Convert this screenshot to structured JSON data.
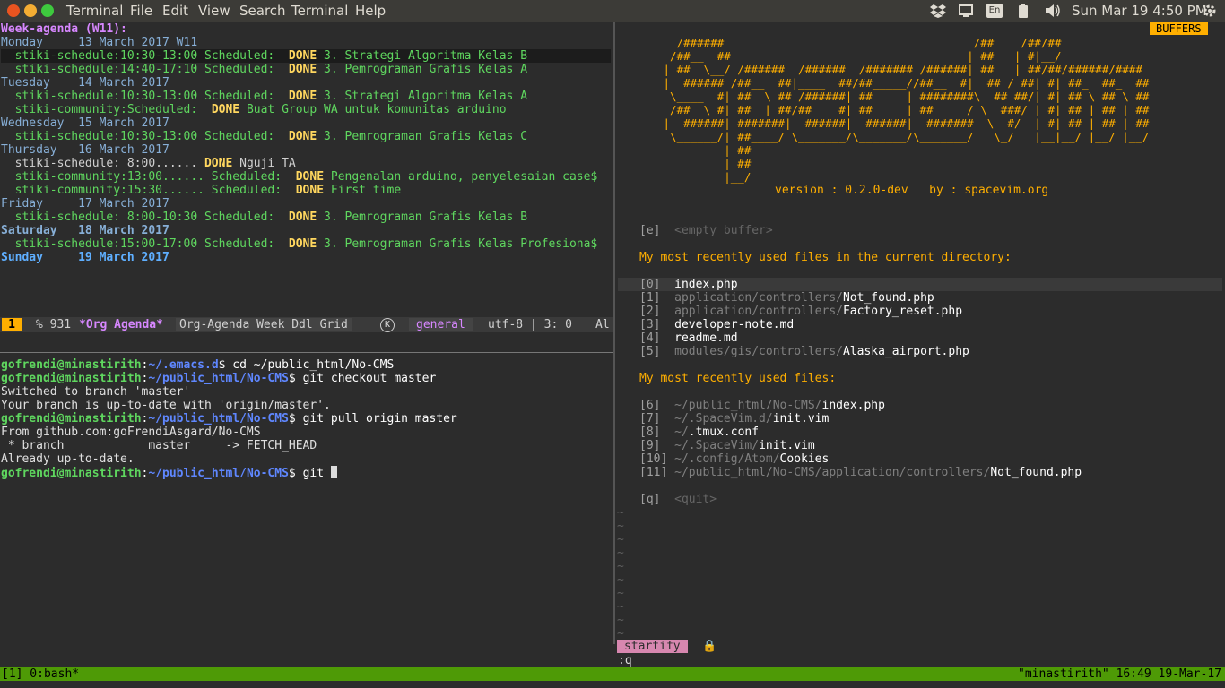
{
  "topbar": {
    "menus": [
      "Terminal",
      "File",
      "Edit",
      "View",
      "Search",
      "Terminal",
      "Help"
    ],
    "keyboard_indicator": "En",
    "clock": "Sun Mar 19  4:50 PM"
  },
  "agenda": {
    "header": "Week-agenda (W11):",
    "lines": [
      {
        "type": "day",
        "text": "Monday     13 March 2017 W11"
      },
      {
        "type": "sched",
        "pre": "  stiki-schedule:10:30-13:00 Scheduled:  ",
        "kw": "DONE",
        "post": " 3. Strategi Algoritma Kelas B",
        "hl": true
      },
      {
        "type": "sched",
        "pre": "  stiki-schedule:14:40-17:10 Scheduled:  ",
        "kw": "DONE",
        "post": " 3. Pemrograman Grafis Kelas A"
      },
      {
        "type": "day",
        "text": "Tuesday    14 March 2017"
      },
      {
        "type": "sched",
        "pre": "  stiki-schedule:10:30-13:00 Scheduled:  ",
        "kw": "DONE",
        "post": " 3. Strategi Algoritma Kelas A"
      },
      {
        "type": "sched",
        "pre": "  stiki-community:Scheduled:  ",
        "kw": "DONE",
        "post": " Buat Group WA untuk komunitas arduino"
      },
      {
        "type": "day",
        "text": "Wednesday  15 March 2017"
      },
      {
        "type": "sched",
        "pre": "  stiki-schedule:10:30-13:00 Scheduled:  ",
        "kw": "DONE",
        "post": " 3. Pemrograman Grafis Kelas C"
      },
      {
        "type": "day",
        "text": "Thursday   16 March 2017"
      },
      {
        "type": "plain",
        "pre": "  stiki-schedule: 8:00...... ",
        "kw": "DONE",
        "post": " Nguji TA"
      },
      {
        "type": "sched",
        "pre": "  stiki-community:13:00...... Scheduled:  ",
        "kw": "DONE",
        "post": " Pengenalan arduino, penyelesaian case$"
      },
      {
        "type": "sched",
        "pre": "  stiki-community:15:30...... Scheduled:  ",
        "kw": "DONE",
        "post": " First time"
      },
      {
        "type": "day",
        "text": "Friday     17 March 2017"
      },
      {
        "type": "sched",
        "pre": "  stiki-schedule: 8:00-10:30 Scheduled:  ",
        "kw": "DONE",
        "post": " 3. Pemrograman Grafis Kelas B"
      },
      {
        "type": "weekend",
        "text": "Saturday   18 March 2017"
      },
      {
        "type": "sched",
        "pre": "  stiki-schedule:15:00-17:00 Scheduled:  ",
        "kw": "DONE",
        "post": " 3. Pemrograman Grafis Kelas Profesiona$"
      },
      {
        "type": "today",
        "text": "Sunday     19 March 2017"
      }
    ]
  },
  "emacs_status": {
    "window_number": "1",
    "position": "% 931",
    "buffer": "*Org Agenda*",
    "mode": "Org-Agenda Week Ddl Grid",
    "k": "K",
    "workspace": "general",
    "encoding": "utf-8 | 3: 0",
    "tail": "Al"
  },
  "shell": {
    "user_host": "gofrendi@minastirith",
    "lines": [
      {
        "path": "~/.emacs.d",
        "cmd": " cd ~/public_html/No-CMS"
      },
      {
        "path": "~/public_html/No-CMS",
        "cmd": " git checkout master"
      },
      {
        "out": "Switched to branch 'master'"
      },
      {
        "out": "Your branch is up-to-date with 'origin/master'."
      },
      {
        "path": "~/public_html/No-CMS",
        "cmd": " git pull origin master"
      },
      {
        "out": "From github.com:goFrendiAsgard/No-CMS"
      },
      {
        "out": " * branch            master     -> FETCH_HEAD"
      },
      {
        "out": "Already up-to-date."
      },
      {
        "path": "~/public_html/No-CMS",
        "cmd": " git "
      }
    ]
  },
  "spacevim": {
    "buffers_label": "BUFFERS",
    "banner": [
      "   /######                                     /##    /##/##",
      "  /##__  ##                                   | ##   | #|__/",
      " | ##  \\__/ /######  /######  /####### /######| ##   | ##/##/######/####",
      " |  ###### /##__  ##|____  ##/##_____//##__  #|  ## / ##| #| ##_  ##_  ##",
      "  \\____  #| ##  \\ ## /######| ##     | ########\\  ## ##/| #| ## \\ ## \\ ##",
      "  /##  \\ #| ##  | ##/##__  #| ##     | ##_____/ \\  ###/ | #| ## | ## | ##",
      " |  ######| #######|  ######|  ######|  #######  \\  #/  | #| ## | ## | ##",
      "  \\______/| ##____/ \\_______/\\_______/\\_______/   \\_/   |__|__/ |__/ |__/",
      "          | ##",
      "          | ##",
      "          |__/"
    ],
    "version_line": "version : 0.2.0-dev   by : spacevim.org",
    "empty_key": "[e]",
    "empty_label": "<empty buffer>",
    "recent_dir_heading": "My most recently used files in the current directory:",
    "recent_dir": [
      {
        "key": "[0]",
        "dir": "",
        "file": "index.php"
      },
      {
        "key": "[1]",
        "dir": "application/controllers/",
        "file": "Not_found.php"
      },
      {
        "key": "[2]",
        "dir": "application/controllers/",
        "file": "Factory_reset.php"
      },
      {
        "key": "[3]",
        "dir": "",
        "file": "developer-note.md"
      },
      {
        "key": "[4]",
        "dir": "",
        "file": "readme.md"
      },
      {
        "key": "[5]",
        "dir": "modules/gis/controllers/",
        "file": "Alaska_airport.php"
      }
    ],
    "recent_heading": "My most recently used files:",
    "recent": [
      {
        "key": "[6]",
        "dir": "~/public_html/No-CMS/",
        "file": "index.php"
      },
      {
        "key": "[7]",
        "dir": "~/.SpaceVim.d/",
        "file": "init.vim"
      },
      {
        "key": "[8]",
        "dir": "~/",
        "file": ".tmux.conf"
      },
      {
        "key": "[9]",
        "dir": "~/.SpaceVim/",
        "file": "init.vim"
      },
      {
        "key": "[10]",
        "dir": "~/.config/Atom/",
        "file": "Cookies"
      },
      {
        "key": "[11]",
        "dir": "~/public_html/No-CMS/application/controllers/",
        "file": "Not_found.php"
      }
    ],
    "quit_key": "[q]",
    "quit_label": "<quit>",
    "tilde": "~",
    "mode_label": "startify",
    "cmdline": ":q"
  },
  "tmux": {
    "left": "[1] 0:bash*",
    "right": "\"minastirith\" 16:49 19-Mar-17"
  }
}
